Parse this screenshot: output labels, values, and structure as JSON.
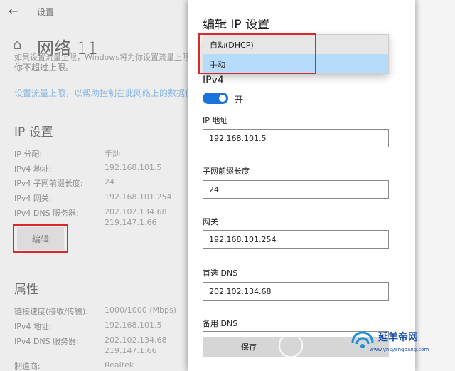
{
  "background": {
    "app_name": "设置",
    "page_title": "网络 11",
    "clip_text": "如果设置流量上限，Windows将为你设置流量上限",
    "line2": "你不超过上限。",
    "link": "设置流量上限，以帮助控制在此网络上的数据使用",
    "ip_section": {
      "title": "IP 设置",
      "rows": [
        {
          "key": "IP 分配:",
          "value": "手动"
        },
        {
          "key": "IPv4 地址:",
          "value": "192.168.101.5"
        },
        {
          "key": "IPv4 子网前缀长度:",
          "value": "24"
        },
        {
          "key": "IPv4 网关:",
          "value": "192.168.101.254"
        },
        {
          "key": "IPv4 DNS 服务器:",
          "value": "202.102.134.68"
        },
        {
          "key": "",
          "value": "219.147.1.66"
        }
      ],
      "edit_button": "编辑"
    },
    "props_section": {
      "title": "属性",
      "rows": [
        {
          "key": "链接速度(接收/传输):",
          "value": "1000/1000 (Mbps)"
        },
        {
          "key": "IPv4 地址:",
          "value": "192.168.101.5"
        },
        {
          "key": "IPv4 DNS 服务器:",
          "value": "202.102.134.68"
        },
        {
          "key": "",
          "value": "219.147.1.66"
        },
        {
          "key": "制造商:",
          "value": "Realtek"
        }
      ]
    }
  },
  "dialog": {
    "title": "编辑 IP 设置",
    "dropdown": {
      "options": [
        "自动(DHCP)",
        "手动"
      ],
      "selected": "手动"
    },
    "ipv4_label": "IPv4",
    "toggle_label": "开",
    "toggle_on": true,
    "fields": [
      {
        "label": "IP 地址",
        "value": "192.168.101.5"
      },
      {
        "label": "子网前缀长度",
        "value": "24"
      },
      {
        "label": "网关",
        "value": "192.168.101.254"
      },
      {
        "label": "首选 DNS",
        "value": "202.102.134.68"
      },
      {
        "label": "备用 DNS",
        "value": ""
      }
    ],
    "save_label": "保存"
  },
  "watermark": {
    "brand": "延羊帝网",
    "url": "www.yncyangbang.com"
  },
  "colors": {
    "accent": "#1a73d8",
    "highlight": "#b7dcfb",
    "annotation_red": "#d9292b",
    "brand_blue": "#1b4fae"
  }
}
